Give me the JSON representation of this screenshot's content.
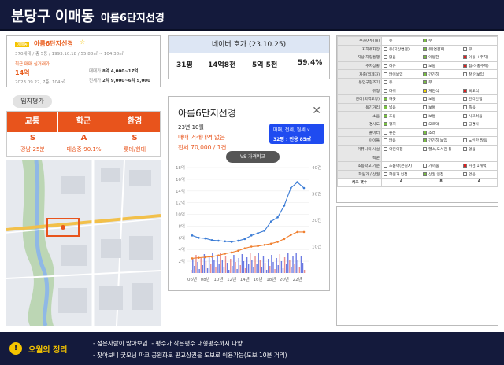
{
  "header": {
    "region": "분당구 이매동",
    "apartment": "아름6단지선경"
  },
  "apt_card": {
    "badge": "이매동",
    "name": "아름6단지선경",
    "meta": "370세대 / 총 5동 / 1993.10.18 / 55.88㎡ ~ 104.38㎡",
    "recent_label": "최근 매매 실거래가",
    "recent_price": "14억",
    "recent_date": "2023.09.22, 7층, 104㎡",
    "sale_label": "매매가",
    "sale_value": "8억 4,000~17억",
    "lease_label": "전세가",
    "lease_value": "2억 9,000~6억 5,000"
  },
  "location": {
    "title": "입지평가",
    "columns": [
      {
        "head": "교통",
        "grade": "S",
        "desc": "강남-25분"
      },
      {
        "head": "학군",
        "grade": "A",
        "desc": "매송중-90.1%"
      },
      {
        "head": "환경",
        "grade": "S",
        "desc": "롯데/현대"
      }
    ]
  },
  "naver": {
    "title": "네이버 호가 (23.10.25)",
    "values": [
      "31평",
      "14억8천",
      "5억 5천",
      "59.4%"
    ]
  },
  "detail": {
    "name": "아름6단지선경",
    "month": "23년 10월",
    "no_trade": "매매 거래내역 없음",
    "lease": "전세 70,000 / 1건",
    "filter_line1": "매매, 전세, 월세 ∨",
    "filter_line2": "32평 : 전용 85㎡",
    "vs_button": "VS 가격비교"
  },
  "chart_data": {
    "type": "line",
    "x": [
      "06년",
      "07년",
      "08년",
      "09년",
      "10년",
      "11년",
      "12년",
      "13년",
      "14년",
      "15년",
      "16년",
      "17년",
      "18년",
      "19년",
      "20년",
      "21년",
      "22년",
      "23년"
    ],
    "x_tick_labels": [
      "06년",
      "08년",
      "10년",
      "12년",
      "14년",
      "16년",
      "18년",
      "20년",
      "22년"
    ],
    "y_left_ticks": [
      "18억",
      "16억",
      "14억",
      "12억",
      "10억",
      "8억",
      "6억",
      "4억",
      "2억"
    ],
    "y_right_ticks": [
      "40건",
      "30건",
      "20건",
      "10건"
    ],
    "y_left_range": [
      0,
      18
    ],
    "y_right_range": [
      0,
      40
    ],
    "series": [
      {
        "color": "#3a7bd5",
        "values": [
          6.4,
          6.0,
          5.9,
          5.6,
          5.5,
          5.4,
          5.3,
          5.5,
          5.8,
          6.4,
          6.8,
          7.2,
          8.8,
          9.5,
          11.5,
          14.5,
          15.5,
          14.5
        ]
      },
      {
        "color": "#f08030",
        "values": [
          2.5,
          2.6,
          2.7,
          2.8,
          3.0,
          3.3,
          3.5,
          3.8,
          4.2,
          4.5,
          4.6,
          4.8,
          5.0,
          5.3,
          5.8,
          6.5,
          7.0,
          7.0
        ]
      }
    ]
  },
  "checklist": {
    "rows": [
      {
        "label": "주차여부(대)",
        "items": [
          {
            "c": "w",
            "t": "유"
          },
          {
            "c": "g",
            "t": "무"
          },
          {
            "c": "",
            "t": ""
          }
        ]
      },
      {
        "label": "지하주차장",
        "items": [
          {
            "c": "w",
            "t": "유(지상연결)"
          },
          {
            "c": "g",
            "t": "유(연결X)"
          },
          {
            "c": "w",
            "t": "무"
          }
        ]
      },
      {
        "label": "지상 차량통행",
        "items": [
          {
            "c": "w",
            "t": "없음"
          },
          {
            "c": "g",
            "t": "이동한"
          },
          {
            "c": "r",
            "t": "이동(+주차)"
          }
        ]
      },
      {
        "label": "주차상황",
        "items": [
          {
            "c": "w",
            "t": "여유"
          },
          {
            "c": "w",
            "t": "보통"
          },
          {
            "c": "r",
            "t": "협(이중주차)"
          }
        ]
      },
      {
        "label": "자중(외제차)",
        "items": [
          {
            "c": "w",
            "t": "많이보임"
          },
          {
            "c": "g",
            "t": "간간히"
          },
          {
            "c": "w",
            "t": "잘 안보임"
          }
        ]
      },
      {
        "label": "동입구현조기",
        "items": [
          {
            "c": "w",
            "t": "유"
          },
          {
            "c": "g",
            "t": "무"
          },
          {
            "c": "",
            "t": ""
          }
        ]
      },
      {
        "label": "유형",
        "items": [
          {
            "c": "w",
            "t": "타워"
          },
          {
            "c": "y",
            "t": "계단식"
          },
          {
            "c": "r",
            "t": "복도식"
          }
        ]
      },
      {
        "label": "관리(외벽포장)",
        "items": [
          {
            "c": "g",
            "t": "깨끗"
          },
          {
            "c": "w",
            "t": "보통"
          },
          {
            "c": "w",
            "t": "관리안됨"
          }
        ]
      },
      {
        "label": "동간거리",
        "items": [
          {
            "c": "g",
            "t": "넓음"
          },
          {
            "c": "w",
            "t": "보통"
          },
          {
            "c": "w",
            "t": "좁음"
          }
        ]
      },
      {
        "label": "소음",
        "items": [
          {
            "c": "g",
            "t": "조용"
          },
          {
            "c": "w",
            "t": "보통"
          },
          {
            "c": "w",
            "t": "시끄러움"
          }
        ]
      },
      {
        "label": "경사도",
        "items": [
          {
            "c": "g",
            "t": "평지"
          },
          {
            "c": "w",
            "t": "오르막"
          },
          {
            "c": "w",
            "t": "급경사"
          }
        ]
      },
      {
        "label": "놀이터",
        "items": [
          {
            "c": "w",
            "t": "좋은"
          },
          {
            "c": "g",
            "t": "조래"
          },
          {
            "c": "",
            "t": ""
          }
        ]
      },
      {
        "label": "아이들",
        "items": [
          {
            "c": "w",
            "t": "많음"
          },
          {
            "c": "g",
            "t": "간간히 보임"
          },
          {
            "c": "w",
            "t": "노인만 많음"
          }
        ]
      },
      {
        "label": "커뮤니티 시설",
        "items": [
          {
            "c": "w",
            "t": "어린이집"
          },
          {
            "c": "w",
            "t": "헬스,도서관 등"
          },
          {
            "c": "w",
            "t": "없음"
          }
        ]
      },
      {
        "label": "학군",
        "items": [
          {
            "c": "",
            "t": ""
          },
          {
            "c": "",
            "t": ""
          },
          {
            "c": "",
            "t": ""
          }
        ]
      },
      {
        "label": "초등학교 기준",
        "items": [
          {
            "c": "w",
            "t": "초품아(큰길X)"
          },
          {
            "c": "w",
            "t": "가까움"
          },
          {
            "c": "r",
            "t": "거검(1캐택)"
          }
        ]
      },
      {
        "label": "학원가 / 상권",
        "items": [
          {
            "c": "w",
            "t": "학원가 인접"
          },
          {
            "c": "g",
            "t": "상권 인접"
          },
          {
            "c": "w",
            "t": "없음"
          }
        ]
      }
    ],
    "total_label": "체크 갯수",
    "totals": [
      "4",
      "8",
      "4"
    ]
  },
  "footer": {
    "label": "오월의 정리",
    "note1": "- 젊은사람이 많아보임.  - 평수가 작은평수 대형평수까지 다양.",
    "note2": "- 찾아보니  굿모닝 파크 공원화로 판교상권을 도보로 이용가능(도보 10분 거리)"
  }
}
